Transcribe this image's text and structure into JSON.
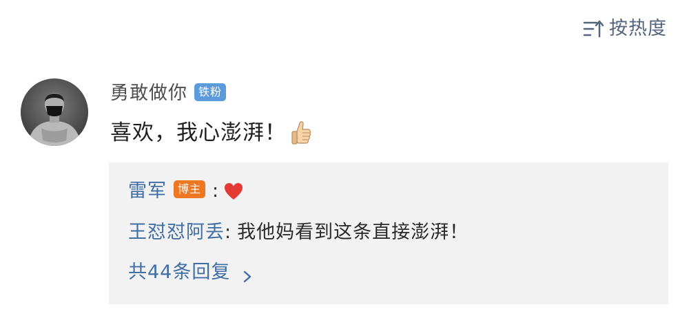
{
  "sort": {
    "label": "按热度",
    "icon": "sort-icon"
  },
  "comment": {
    "avatar_icon": "user-avatar",
    "username": "勇敢做你",
    "badge": "铁粉",
    "text": "喜欢，我心澎湃！",
    "emoji": "thumbs-up-icon"
  },
  "replies": [
    {
      "author": "雷军",
      "badge": "博主",
      "separator": ":",
      "content_icon": "heart-icon"
    },
    {
      "author": "王怼怼阿丢",
      "separator": ":",
      "text": "我他妈看到这条直接澎湃！"
    }
  ],
  "more_replies": {
    "label": "共44条回复",
    "icon": "chevron-right-icon"
  },
  "colors": {
    "link": "#3f6ea5",
    "fan_badge": "#5b9bdb",
    "host_badge": "#ee7722",
    "reply_bg": "#f2f2f2"
  }
}
